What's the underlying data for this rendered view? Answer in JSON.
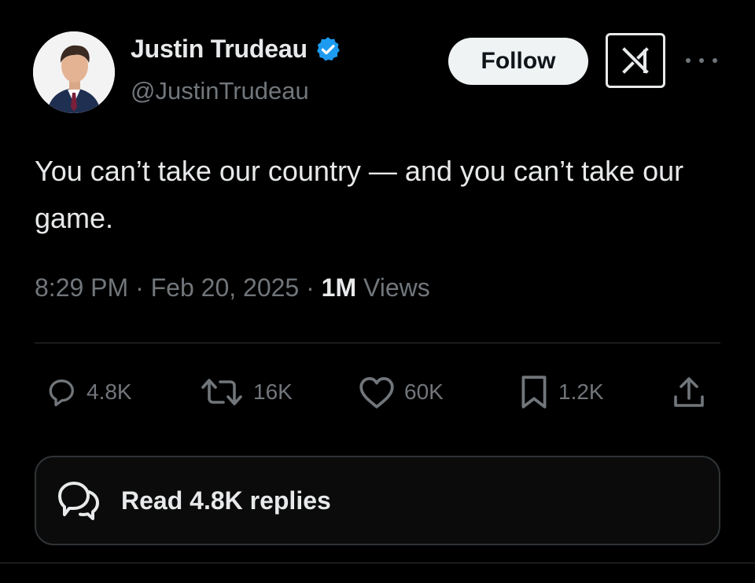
{
  "author": {
    "display_name": "Justin Trudeau",
    "handle": "@JustinTrudeau",
    "verified": true
  },
  "header": {
    "follow_label": "Follow",
    "grok_icon": "grok-icon",
    "more_icon": "more-icon"
  },
  "tweet": {
    "text": "You can’t take our country — and you can’t take our game."
  },
  "meta": {
    "time": "8:29 PM",
    "separator1": " · ",
    "date": "Feb 20, 2025",
    "separator2": " · ",
    "views_count": "1M",
    "views_label": " Views"
  },
  "actions": {
    "replies": "4.8K",
    "reposts": "16K",
    "likes": "60K",
    "bookmarks": "1.2K",
    "share_icon": "share-icon"
  },
  "read_replies": {
    "label": "Read 4.8K replies"
  },
  "colors": {
    "background": "#000000",
    "text_primary": "#e7e9ea",
    "text_secondary": "#71767b",
    "verified_blue": "#1d9bf0",
    "divider": "#2f3336"
  }
}
